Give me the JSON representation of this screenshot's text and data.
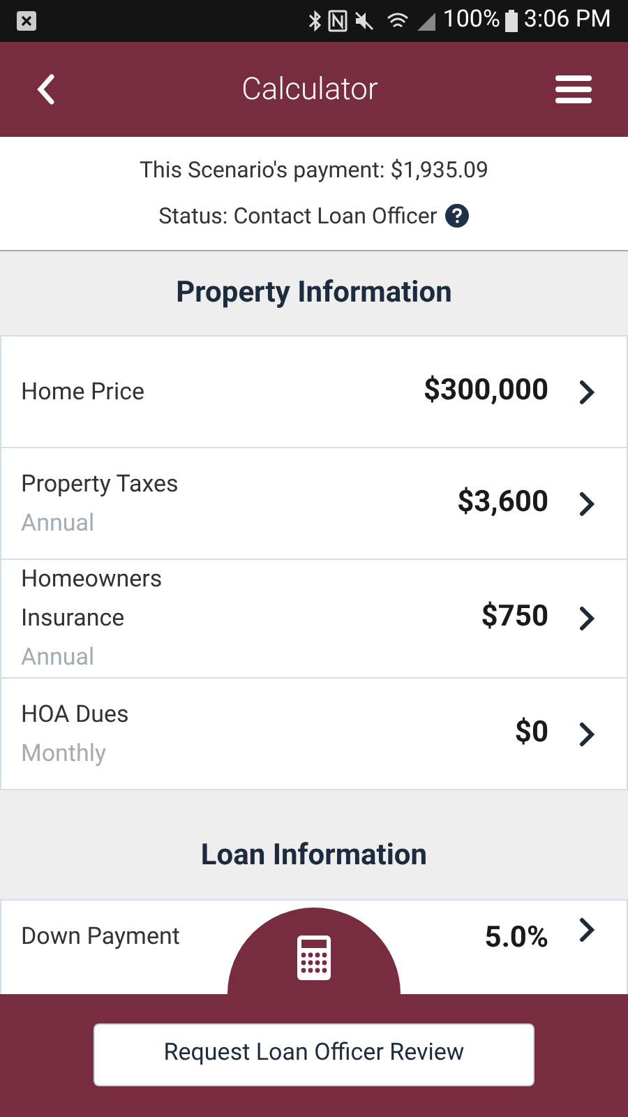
{
  "status_bar": {
    "battery": "100%",
    "time": "3:06 PM"
  },
  "header": {
    "title": "Calculator"
  },
  "summary": {
    "payment": "This Scenario's payment: $1,935.09",
    "status": "Status: Contact Loan Officer"
  },
  "sections": [
    {
      "title": "Property Information",
      "rows": [
        {
          "label": "Home Price",
          "value": "$300,000"
        },
        {
          "label": "Property Taxes",
          "sublabel": "Annual",
          "value": "$3,600"
        },
        {
          "label": "Homeowners Insurance",
          "sublabel": "Annual",
          "value": "$750"
        },
        {
          "label": "HOA Dues",
          "sublabel": "Monthly",
          "value": "$0"
        }
      ]
    },
    {
      "title": "Loan Information",
      "rows": [
        {
          "label": "Down Payment",
          "value": "5.0%"
        }
      ]
    }
  ],
  "bottom_bar": {
    "button": "Request Loan Officer Review"
  }
}
